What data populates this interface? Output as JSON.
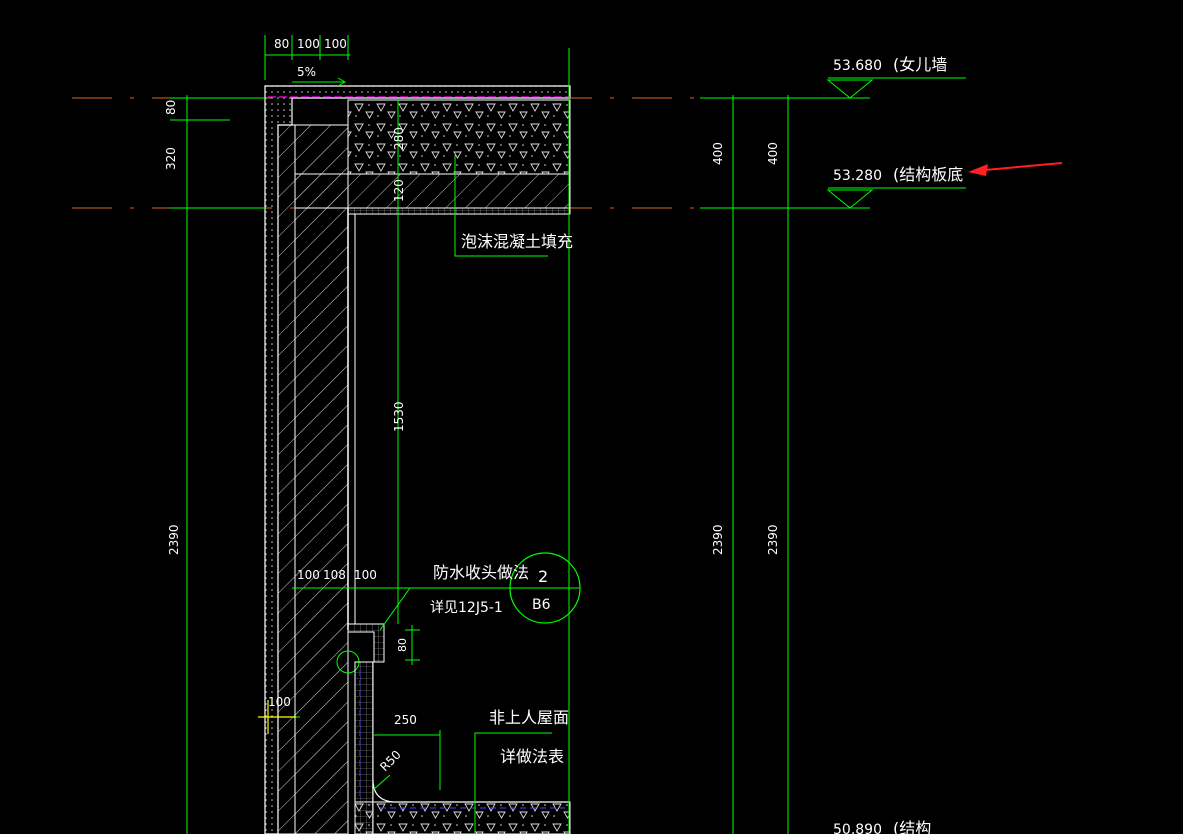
{
  "colors": {
    "background": "#000000",
    "dimension": "#00ff00",
    "wall": "#ffffff",
    "hatch": "#bfbfbf",
    "axis": "#d2691e",
    "membrane": "#ff00ff",
    "arrow": "#ff2020",
    "marker": "#ffff00",
    "text": "#ffffff"
  },
  "drawing": {
    "top_dims": [
      "80",
      "100",
      "100"
    ],
    "slope": "5%",
    "left_dims": {
      "upper": "80",
      "middle": "320",
      "long": "2390"
    },
    "slab_dims": {
      "fill": "280",
      "slab": "120",
      "inner": "1530"
    },
    "right_dims": {
      "a": "400",
      "b": "400",
      "c": "2390",
      "d": "2390"
    },
    "levels": [
      {
        "value": "53.680",
        "label": "女儿墙"
      },
      {
        "value": "53.280",
        "label": "结构板底"
      },
      {
        "value": "50.890",
        "label": "结构"
      }
    ],
    "callouts": {
      "foam": "泡沫混凝土填充",
      "waterproof": "防水收头做法",
      "detail_ref": "详见12J5-1",
      "roof": "非上人屋面",
      "roof_ref": "详做法表"
    },
    "detail_symbol": {
      "number": "2",
      "sheet": "B6"
    },
    "step_dims": {
      "a": "100",
      "b": "108",
      "c": "100",
      "height": "80"
    },
    "bottom_dims": {
      "width": "250",
      "diag": "R50",
      "left": "100"
    }
  }
}
